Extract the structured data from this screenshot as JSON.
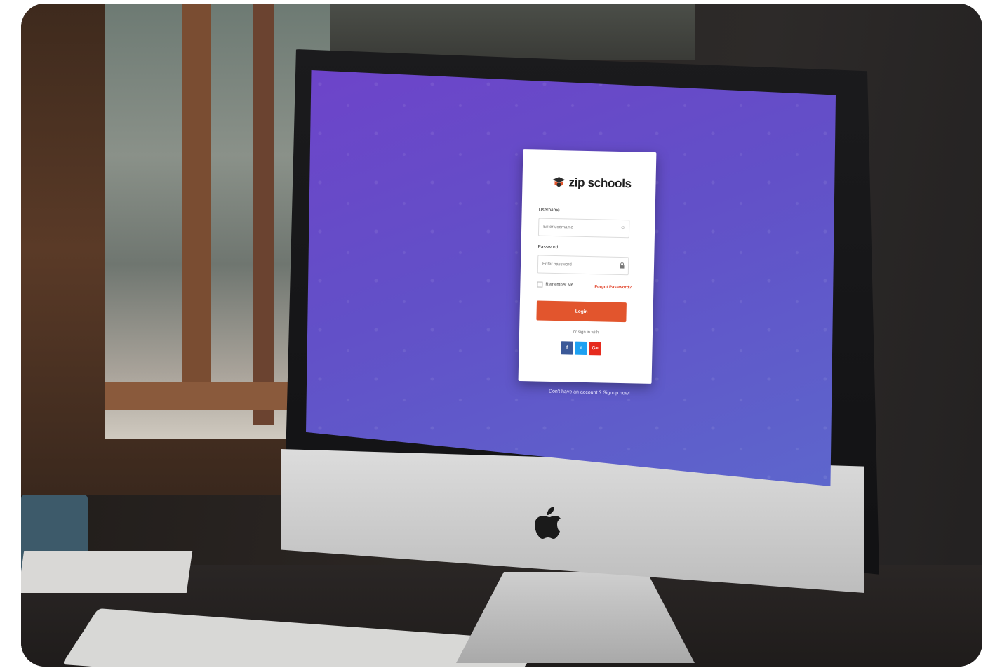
{
  "brand": {
    "name": "zip schools",
    "cap_icon": "graduation-cap-icon",
    "accent": "#e2552d",
    "bg_gradient": [
      "#6d44c9",
      "#5d66cc"
    ]
  },
  "login": {
    "username_label": "Username",
    "username_placeholder": "Enter username",
    "username_icon": "user-icon",
    "password_label": "Password",
    "password_placeholder": "Enter password",
    "password_icon": "lock-icon",
    "remember_label": "Remember Me",
    "forgot_label": "Forgot Password?",
    "login_button": "Login",
    "or_sign_in": "or sign in with",
    "social": [
      {
        "name": "facebook",
        "glyph": "f",
        "color": "#3b5998"
      },
      {
        "name": "twitter",
        "glyph": "t",
        "color": "#1da1f2"
      },
      {
        "name": "google-plus",
        "glyph": "G+",
        "color": "#e62b1e"
      }
    ]
  },
  "footer": {
    "signup_text": "Don't have an account ? Signup now!"
  },
  "device": {
    "logo": "apple-logo-icon"
  }
}
